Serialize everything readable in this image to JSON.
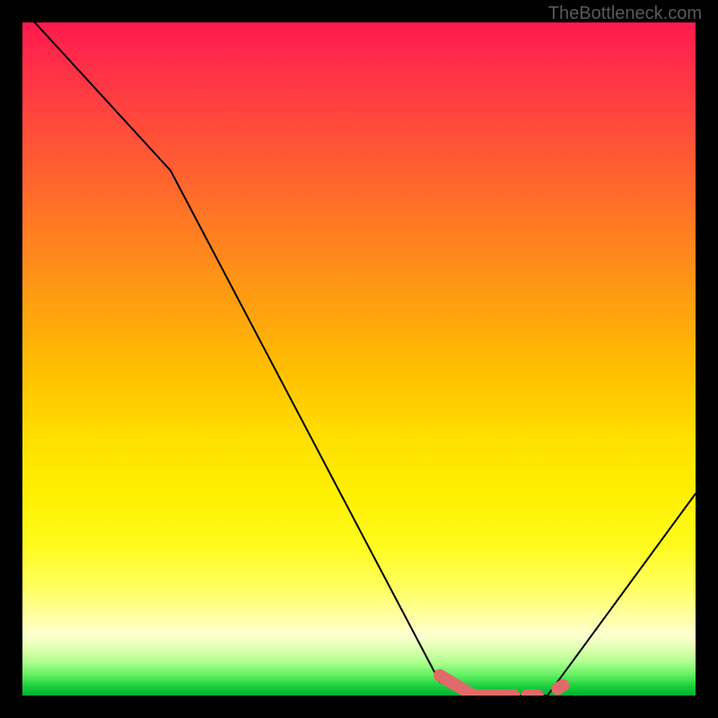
{
  "watermark": "TheBottleneck.com",
  "chart_data": {
    "type": "line",
    "title": "",
    "xlabel": "",
    "ylabel": "",
    "xlim": [
      0,
      100
    ],
    "ylim": [
      0,
      100
    ],
    "grid": false,
    "series": [
      {
        "name": "curve",
        "color": "#000000",
        "x": [
          0,
          22,
          62,
          67,
          78,
          100
        ],
        "y": [
          102,
          78,
          2,
          0,
          0,
          30
        ]
      },
      {
        "name": "highlight-segment-1",
        "color": "#e06a6a",
        "thick": true,
        "x": [
          62,
          67,
          73
        ],
        "y": [
          3,
          0,
          0
        ]
      },
      {
        "name": "highlight-dot-2",
        "color": "#e06a6a",
        "thick": true,
        "x": [
          75,
          76.5
        ],
        "y": [
          0,
          0
        ]
      },
      {
        "name": "highlight-dot-3",
        "color": "#e06a6a",
        "thick": true,
        "x": [
          79.5,
          80.3
        ],
        "y": [
          1,
          1.5
        ]
      }
    ],
    "gradient_stops": [
      {
        "pct": 0,
        "color": "#ff1a4d"
      },
      {
        "pct": 12,
        "color": "#ff4040"
      },
      {
        "pct": 32,
        "color": "#ff8020"
      },
      {
        "pct": 52,
        "color": "#ffc000"
      },
      {
        "pct": 78,
        "color": "#fffb20"
      },
      {
        "pct": 91,
        "color": "#ffffd0"
      },
      {
        "pct": 97,
        "color": "#60f060"
      },
      {
        "pct": 100,
        "color": "#00b030"
      }
    ]
  }
}
